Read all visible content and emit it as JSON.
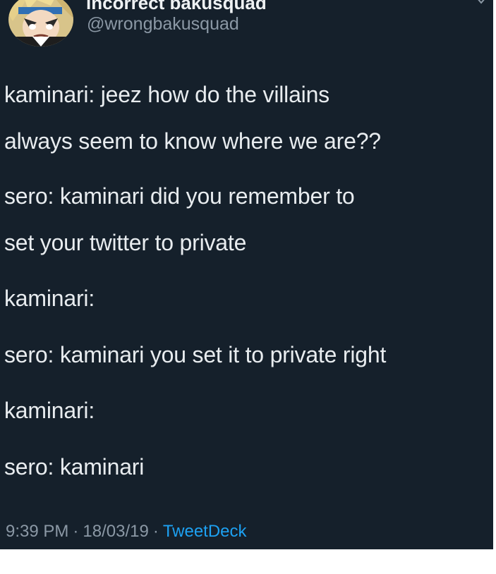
{
  "tweet": {
    "author": {
      "display_name": "incorrect bakusquad",
      "handle": "@wrongbakusquad",
      "avatar_icon": "anime-character-avatar-icon"
    },
    "lines": [
      "kaminari: jeez how do the villains",
      "always seem to know where we are??",
      "sero: kaminari did you remember to",
      "set your twitter to private",
      "kaminari:",
      "sero: kaminari you set it to private right",
      "kaminari:",
      "sero: kaminari"
    ],
    "meta": {
      "time": "9:39 PM",
      "separator": "·",
      "date": "18/03/19",
      "source": "TweetDeck"
    }
  },
  "colors": {
    "card_background": "#15202b",
    "text": "#e8ecef",
    "secondary_text": "#8b98a5",
    "link": "#1da1f2",
    "page_background": "#ffffff"
  }
}
